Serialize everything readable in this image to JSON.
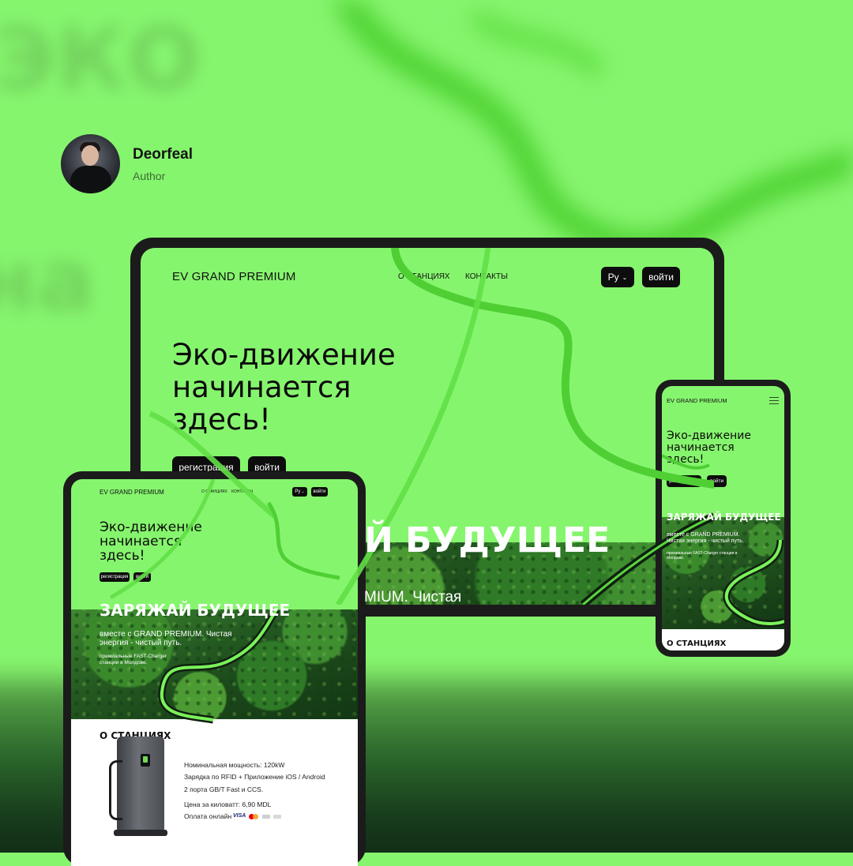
{
  "author": {
    "name": "Deorfeal",
    "role": "Author"
  },
  "site": {
    "brand": "EV GRAND PREMIUM",
    "nav": [
      "О СТАНЦИЯХ",
      "КОНТАКТЫ"
    ],
    "lang": "Ру",
    "login": "войти",
    "hero_lines": [
      "Эко-движение",
      "начинается",
      "здесь!"
    ],
    "register": "регистрация",
    "charge_title": "ЗАРЯЖАЙ БУДУЩЕЕ",
    "charge_partial": "Й БУДУЩЕЕ",
    "tagline_lines": [
      "вместе с GRAND PREMIUM. Чистая",
      "энергия - чистый путь."
    ],
    "tagline_partial": "MIUM. Чистая",
    "small_lines": [
      "премиальные FAST-Charger",
      "станции в Молдове."
    ],
    "phone_tagline_lines": [
      "вместе с GRAND PREMIUM.",
      "Чистая энергия - чистый путь."
    ],
    "phone_small_lines": [
      "премиальные FAST-Charger станции в",
      "Молдове."
    ],
    "about_title": "О СТАНЦИЯХ",
    "specs": [
      "Номинальная мощность: 120kW",
      "Зарядка по RFID + Приложение iOS / Android",
      "2 порта GB/T Fast и CCS.",
      "Цена за киловатт: 6,90 MDL",
      "Оплата онлайн"
    ],
    "payment": [
      "VISA"
    ]
  },
  "colors": {
    "accent": "#86f56e",
    "road": "#5ad63f",
    "dark": "#0d0d0d"
  },
  "icons": [
    "menu-icon",
    "chevron-down-icon",
    "plug-icon",
    "mastercard-icon"
  ]
}
